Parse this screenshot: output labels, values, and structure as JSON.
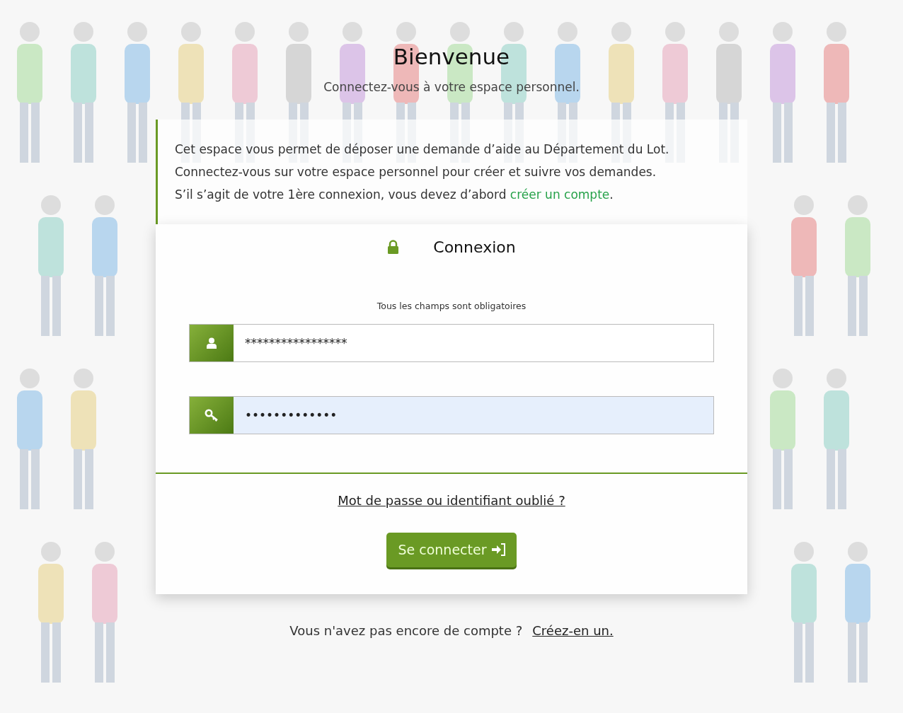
{
  "header": {
    "title": "Bienvenue",
    "subtitle": "Connectez-vous à votre espace personnel."
  },
  "info": {
    "lines": [
      "Cet espace vous permet de déposer une demande d’aide au Département du Lot.",
      "Connectez-vous sur votre espace personnel pour créer et suivre vos demandes."
    ],
    "last_line": {
      "text": "S’il s’agit de votre 1ère connexion, vous devez d’abord ",
      "link": "créer un compte",
      "after": "."
    }
  },
  "login": {
    "title": "Connexion",
    "required_note": "Tous les champs sont obligatoires",
    "fields": [
      {
        "kind": "user",
        "value": "*****************",
        "autofilled": false
      },
      {
        "kind": "password",
        "value": "•••••••••••••",
        "autofilled": true
      }
    ],
    "forgot_link": "Mot de passe ou identifiant oublié ?",
    "submit": "Se connecter"
  },
  "footer": {
    "text": "Vous n'avez pas encore de compte ?",
    "link": "Créez-en un."
  }
}
